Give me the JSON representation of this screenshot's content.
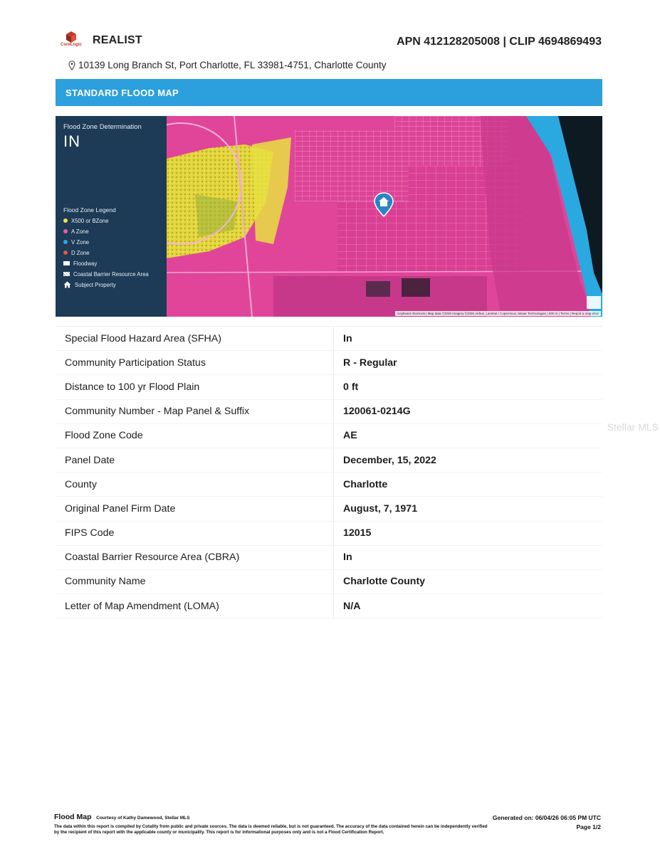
{
  "header": {
    "brand_small": "CoreLogic",
    "brand_name": "REALIST",
    "apn_clip": "APN 412128205008 | CLIP 4694869493",
    "address": "10139 Long Branch St, Port Charlotte, FL 33981-4751, Charlotte County"
  },
  "section": {
    "title": "STANDARD FLOOD MAP"
  },
  "map": {
    "determination_label": "Flood Zone Determination",
    "determination_value": "IN",
    "legend_title": "Flood Zone Legend",
    "legend": [
      {
        "label": "X500 or BZone",
        "color": "#f2e33a",
        "icon": "dot"
      },
      {
        "label": "A Zone",
        "color": "#e85aa8",
        "icon": "dot"
      },
      {
        "label": "V Zone",
        "color": "#29a9e0",
        "icon": "dot"
      },
      {
        "label": "D Zone",
        "color": "#e05a3c",
        "icon": "dot"
      },
      {
        "label": "Floodway",
        "color": "#ffffff",
        "icon": "floodway-icon"
      },
      {
        "label": "Coastal Barrier Resource Area",
        "color": "#ffffff",
        "icon": "cbra-icon"
      },
      {
        "label": "Subject Property",
        "color": "#ffffff",
        "icon": "house-icon"
      }
    ],
    "attribution": "Keyboard shortcuts | Map data ©2026 Imagery ©2026 Airbus, Landsat / Copernicus, Maxar Technologies | 500 m | Terms | Report a map error"
  },
  "table": [
    {
      "label": "Special Flood Hazard Area (SFHA)",
      "value": "In"
    },
    {
      "label": "Community Participation Status",
      "value": "R - Regular"
    },
    {
      "label": "Distance to 100 yr Flood Plain",
      "value": "0 ft"
    },
    {
      "label": "Community Number - Map Panel & Suffix",
      "value": "120061-0214G"
    },
    {
      "label": "Flood Zone Code",
      "value": "AE"
    },
    {
      "label": "Panel Date",
      "value": "December, 15, 2022"
    },
    {
      "label": "County",
      "value": "Charlotte"
    },
    {
      "label": "Original Panel Firm Date",
      "value": "August, 7, 1971"
    },
    {
      "label": "FIPS Code",
      "value": "12015"
    },
    {
      "label": "Coastal Barrier Resource Area (CBRA)",
      "value": "In"
    },
    {
      "label": "Community Name",
      "value": "Charlotte County"
    },
    {
      "label": "Letter of Map Amendment (LOMA)",
      "value": "N/A"
    }
  ],
  "watermark": "Stellar MLS",
  "footer": {
    "title": "Flood Map",
    "courtesy": "Courtesy of Kathy Damewood, Stellar MLS",
    "disclaimer": "The data within this report is compiled by Cotality from public and private sources. The data is deemed reliable, but is not guaranteed. The accuracy of the data contained herein can be independently verified by the recipient of this report with the applicable county or municipality. This report is for informational purposes only and is not a Flood Certification Report.",
    "generated": "Generated on: 06/04/26 06:05 PM UTC",
    "page": "Page 1/2"
  },
  "colors": {
    "banner": "#2ca0dd",
    "legend_panel": "#1d3a56",
    "a_zone_map": "#e0459a",
    "x500_map": "#e6e040",
    "coast_water": "#29a9e0"
  }
}
